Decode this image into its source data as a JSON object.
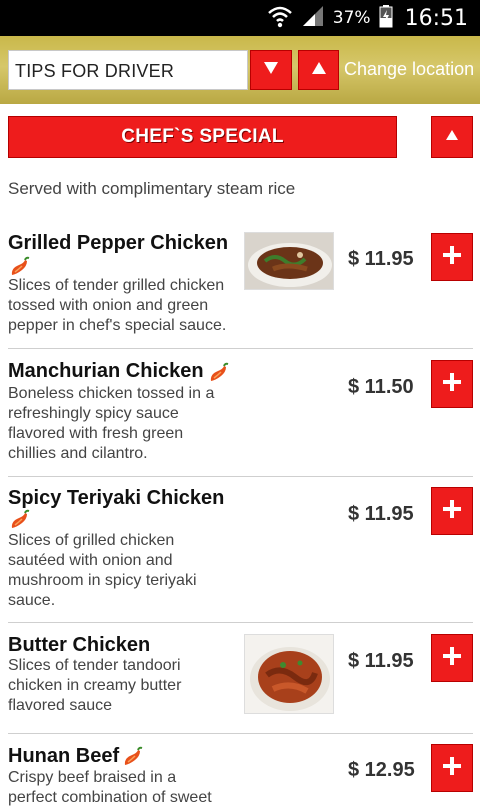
{
  "status_bar": {
    "battery_percent": "37%",
    "time": "16:51"
  },
  "header": {
    "tips_select_value": "TIPS FOR DRIVER",
    "change_location_label": "Change location"
  },
  "section": {
    "title": "CHEF`S SPECIAL",
    "note": "Served with complimentary steam rice"
  },
  "items": [
    {
      "name": "Grilled Pepper Chicken",
      "spicy": true,
      "desc": [
        "Slices of tender grilled chicken",
        "tossed with onion and green",
        "pepper in chef's special sauce."
      ],
      "price": "$ 11.95",
      "has_photo": true
    },
    {
      "name": "Manchurian Chicken",
      "spicy": true,
      "desc": [
        "Boneless chicken tossed in a",
        "refreshingly spicy sauce",
        "flavored with fresh green",
        "chillies and cilantro."
      ],
      "price": "$ 11.50",
      "has_photo": false
    },
    {
      "name": "Spicy Teriyaki Chicken",
      "spicy": true,
      "desc": [
        "Slices of grilled chicken",
        "sautéed with onion and",
        "mushroom in spicy teriyaki",
        "sauce."
      ],
      "price": "$ 11.95",
      "has_photo": false
    },
    {
      "name": "Butter Chicken",
      "spicy": false,
      "desc": [
        "Slices of tender tandoori",
        "chicken in creamy butter",
        "flavored sauce"
      ],
      "price": "$ 11.95",
      "has_photo": true
    },
    {
      "name": "Hunan Beef",
      "spicy": true,
      "desc": [
        "Crispy beef braised in a",
        "perfect combination of sweet"
      ],
      "price": "$ 12.95",
      "has_photo": false
    }
  ],
  "icons": {
    "status": [
      "wifi-icon",
      "signal-icon",
      "battery-icon"
    ],
    "dropdown": "caret-down-icon",
    "collapse": "caret-up-icon",
    "add": "plus-icon",
    "spicy": "chili-pepper-icon"
  },
  "colors": {
    "accent_red": "#ee1c1c",
    "banner_gold": "#c9b84a"
  }
}
